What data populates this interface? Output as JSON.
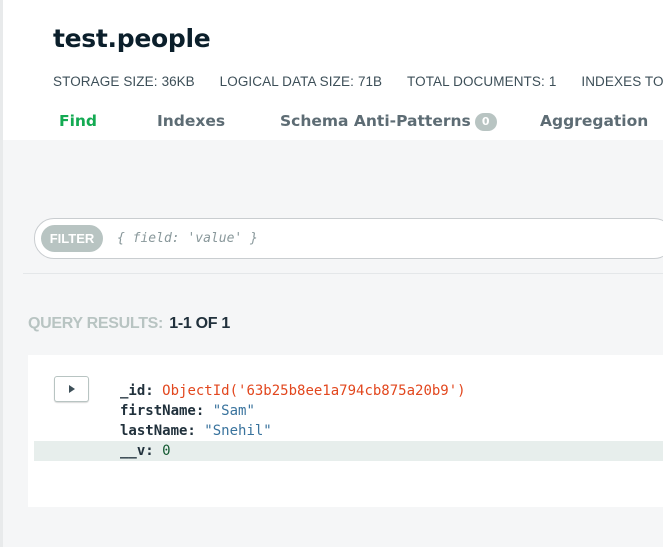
{
  "collection": {
    "title": "test.people"
  },
  "stats": [
    {
      "label": "STORAGE SIZE:",
      "value": "36KB"
    },
    {
      "label": "LOGICAL DATA SIZE:",
      "value": "71B"
    },
    {
      "label": "TOTAL DOCUMENTS:",
      "value": "1"
    },
    {
      "label": "INDEXES TOTA",
      "value": ""
    }
  ],
  "tabs": [
    {
      "label": "Find",
      "active": true
    },
    {
      "label": "Indexes",
      "active": false
    },
    {
      "label": "Schema Anti-Patterns",
      "badge": "0",
      "active": false
    },
    {
      "label": "Aggregation",
      "active": false
    }
  ],
  "filter": {
    "label": "FILTER",
    "placeholder": "{ field: 'value' }"
  },
  "results": {
    "label": "QUERY RESULTS:",
    "count": "1-1 OF 1"
  },
  "document": {
    "fields": [
      {
        "key": "_id:",
        "value": "ObjectId('63b25b8ee1a794cb875a20b9')",
        "type": "oid"
      },
      {
        "key": "firstName:",
        "value": "\"Sam\"",
        "type": "str"
      },
      {
        "key": "lastName:",
        "value": "\"Snehil\"",
        "type": "str"
      },
      {
        "key": "__v:",
        "value": "0",
        "type": "num"
      }
    ]
  },
  "colors": {
    "accent": "#13aa52",
    "oid": "#e2471e",
    "string": "#39739d",
    "number": "#145a32"
  }
}
